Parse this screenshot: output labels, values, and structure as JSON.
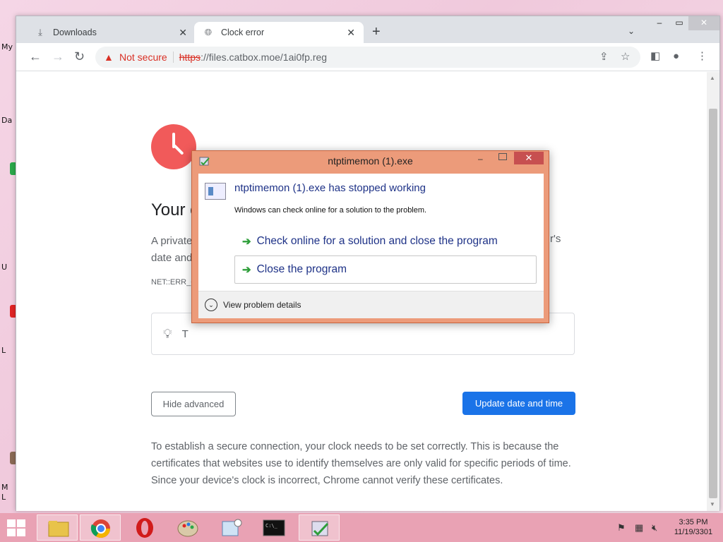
{
  "desktop": {
    "labels": [
      "My",
      "Da",
      "U",
      "L",
      "M",
      "L"
    ]
  },
  "browser": {
    "tabs": [
      {
        "label": "Downloads",
        "icon": "download-icon"
      },
      {
        "label": "Clock error",
        "icon": "globe-icon"
      }
    ],
    "address": {
      "security": "Not secure",
      "scheme": "https",
      "rest": "://files.catbox.moe/1ai0fp.reg"
    }
  },
  "page": {
    "heading": "Your c",
    "body_line1": "A private",
    "body_line2": "date and",
    "body_tail": "r's",
    "error_code": "NET::ERR_C",
    "tip_text": "T",
    "hide_advanced": "Hide advanced",
    "update_button": "Update date and time",
    "explanation": "To establish a secure connection, your clock needs to be set correctly. This is because the certificates that websites use to identify themselves are only valid for specific periods of time. Since your device's clock is incorrect, Chrome cannot verify these certificates."
  },
  "dialog": {
    "title": "ntptimemon (1).exe",
    "heading": "ntptimemon (1).exe has stopped working",
    "subtext": "Windows can check online for a solution to the problem.",
    "option1": "Check online for a solution and close the program",
    "option2": "Close the program",
    "details": "View problem details"
  },
  "taskbar": {
    "time": "3:35 PM",
    "date": "11/19/3301"
  },
  "colors": {
    "accent_blue": "#1a73e8",
    "danger_red": "#d93025",
    "dialog_frame": "#ec9b7a",
    "taskbar": "#e9a2b4"
  }
}
